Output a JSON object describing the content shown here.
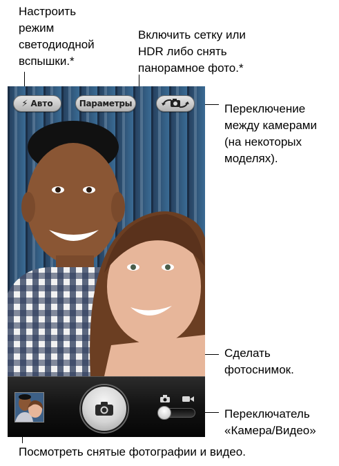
{
  "callouts": {
    "flash": "Настроить\nрежим\nсветодиодной\nвспышки.*",
    "options": "Включить сетку или\nHDR либо снять\nпанорамное фото.*",
    "switch_camera": "Переключение\nмежду камерами\n(на некоторых\nмоделях).",
    "shutter": "Сделать\nфотоснимок.",
    "mode_switch": "Переключатель\n«Камера/Видео»",
    "thumbnail": "Посмотреть снятые фотографии и видео."
  },
  "camera_ui": {
    "flash_button": "Авто",
    "options_button": "Параметры"
  },
  "icons": {
    "flash": "lightning-bolt-icon",
    "switch_camera": "camera-flip-icon",
    "shutter": "camera-icon",
    "mode_photo": "camera-icon",
    "mode_video": "video-camera-icon"
  },
  "colors": {
    "toolbar": "#121212",
    "pill_button": "#cfcfcf",
    "backdrop": "#2c4f72"
  }
}
